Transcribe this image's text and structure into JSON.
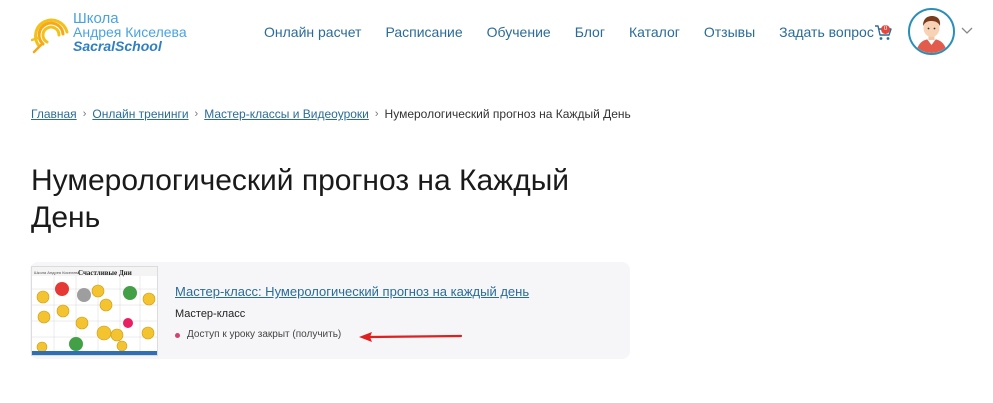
{
  "logo": {
    "line1": "Школа",
    "line2": "Андрея Киселева",
    "line3": "SacralSchool"
  },
  "nav": [
    {
      "label": "Онлайн расчет"
    },
    {
      "label": "Расписание"
    },
    {
      "label": "Обучение"
    },
    {
      "label": "Блог"
    },
    {
      "label": "Каталог"
    },
    {
      "label": "Отзывы"
    },
    {
      "label": "Задать вопрос"
    }
  ],
  "cart": {
    "count": "0",
    "icon": "cart-icon"
  },
  "user": {
    "icon": "avatar-icon"
  },
  "breadcrumb": {
    "items": [
      "Главная",
      "Онлайн тренинги",
      "Мастер-классы и Видеоуроки"
    ],
    "current": "Нумерологический прогноз на Каждый День"
  },
  "page": {
    "title": "Нумерологический прогноз на Каждый День"
  },
  "card": {
    "thumb_title": "Счастливые Дни",
    "thumb_header": "Школа Андрея Киселева",
    "title": "Мастер-класс: Нумерологический прогноз на каждый день",
    "type": "Мастер-класс",
    "status": "Доступ к уроку закрыт (получить)"
  },
  "colors": {
    "link": "#2a6c98",
    "accent": "#2a8fb8",
    "status_dot": "#d6416a",
    "arrow": "#e02020"
  }
}
